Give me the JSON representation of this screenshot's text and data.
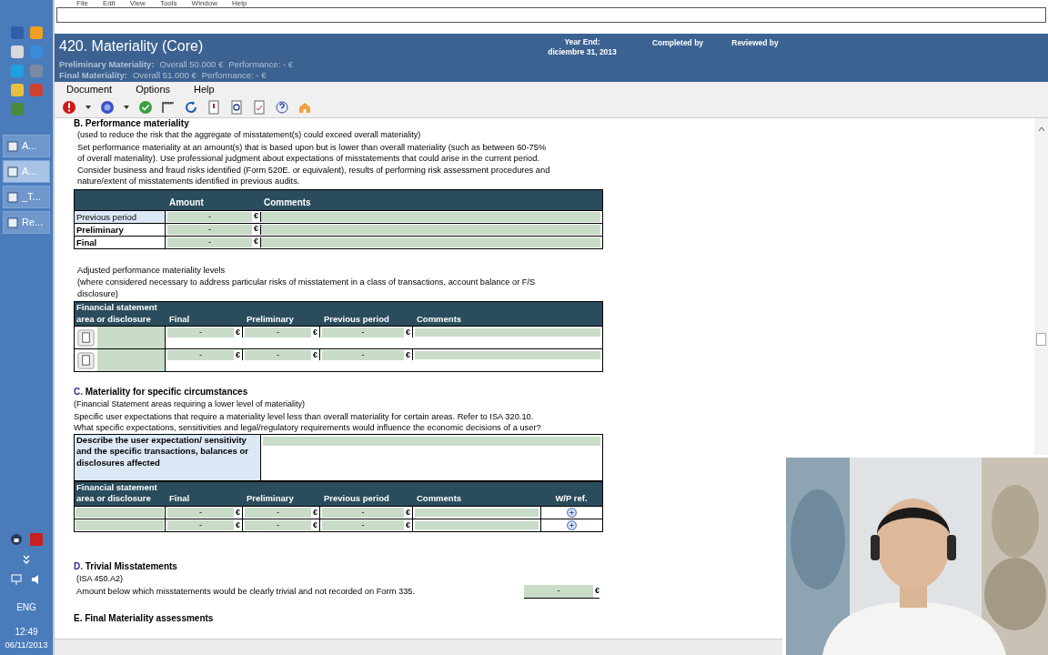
{
  "app_menu": [
    "File",
    "Edit",
    "View",
    "Tools",
    "Window",
    "Help"
  ],
  "header": {
    "title": "420. Materiality (Core)",
    "year_end_label": "Year End:",
    "year_end_value": "diciembre 31, 2013",
    "completed_by": "Completed by",
    "reviewed_by": "Reviewed by",
    "lines": [
      {
        "label": "Preliminary Materiality:",
        "overall": "Overall 50.000 €",
        "performance": "Performance:  - €"
      },
      {
        "label": "Final Materiality:",
        "overall": "Overall 51.000 €",
        "performance": "Performance:  - €"
      }
    ]
  },
  "menubar": [
    "Document",
    "Options",
    "Help"
  ],
  "section_b": {
    "heading": "B. Performance materiality",
    "note": "(used to reduce the risk that the aggregate of misstatement(s) could exceed overall materiality)",
    "text": "Set performance materiality at an amount(s) that is based upon but is lower than overall materiality (such as between 60-75% of overall materiality). Use professional judgment about expectations of misstatements that could arise in the current period. Consider business and fraud risks identified (Form 520E. or equivalent), results of performing risk assessment procedures and nature/extent of misstatements identified in previous audits.",
    "columns": [
      "Amount",
      "Comments"
    ],
    "rows": [
      {
        "label": "Previous period",
        "highlighted": true,
        "value": "-",
        "currency": "€"
      },
      {
        "label": "Preliminary",
        "highlighted": false,
        "value": "-",
        "currency": "€"
      },
      {
        "label": "Final",
        "highlighted": false,
        "value": "-",
        "currency": "€"
      }
    ]
  },
  "adjusted": {
    "title": "Adjusted performance materiality levels",
    "note": "(where considered necessary to address particular risks of misstatement in a class of transactions, account balance or F/S disclosure)",
    "columns": [
      "Financial statement area or disclosure",
      "Final",
      "Preliminary",
      "Previous period",
      "Comments"
    ],
    "rows": [
      {
        "values": [
          "-",
          "-",
          "-"
        ],
        "currency": "€"
      },
      {
        "values": [
          "-",
          "-",
          "-"
        ],
        "currency": "€"
      }
    ]
  },
  "section_c": {
    "letter": "C.",
    "title": "Materiality for specific circumstances",
    "note": "(Financial Statement areas requiring a lower level of materiality)",
    "text": "Specific user expectations that require a materiality level less than overall materiality for certain areas. Refer to ISA 320.10. What specific expectations, sensitivities and legal/regulatory requirements would influence the economic decisions of a user?",
    "describe_label": "Describe the user expectation/ sensitivity and the specific transactions, balances or disclosures affected",
    "columns": [
      "Financial statement area or disclosure",
      "Final",
      "Preliminary",
      "Previous period",
      "Comments",
      "W/P ref."
    ],
    "rows": [
      {
        "values": [
          "-",
          "-",
          "-"
        ],
        "currency": "€"
      },
      {
        "values": [
          "-",
          "-",
          "-"
        ],
        "currency": "€"
      }
    ]
  },
  "section_d": {
    "letter": "D.",
    "title": "Trivial Misstatements",
    "note": "(ISA 450.A2)",
    "text": "Amount below which misstatements would be clearly trivial and not recorded on Form 335.",
    "value": "-",
    "currency": "€"
  },
  "section_e": {
    "heading": "E. Final Materiality assessments"
  },
  "taskbar": {
    "tasks": [
      {
        "label": "A...",
        "selected": false
      },
      {
        "label": "A...",
        "selected": true
      },
      {
        "label": "_T...",
        "selected": false
      },
      {
        "label": "Re...",
        "selected": false
      }
    ],
    "language": "ENG",
    "time": "12:49",
    "date": "06/11/2013"
  },
  "webcam": {
    "kind": "picture"
  }
}
